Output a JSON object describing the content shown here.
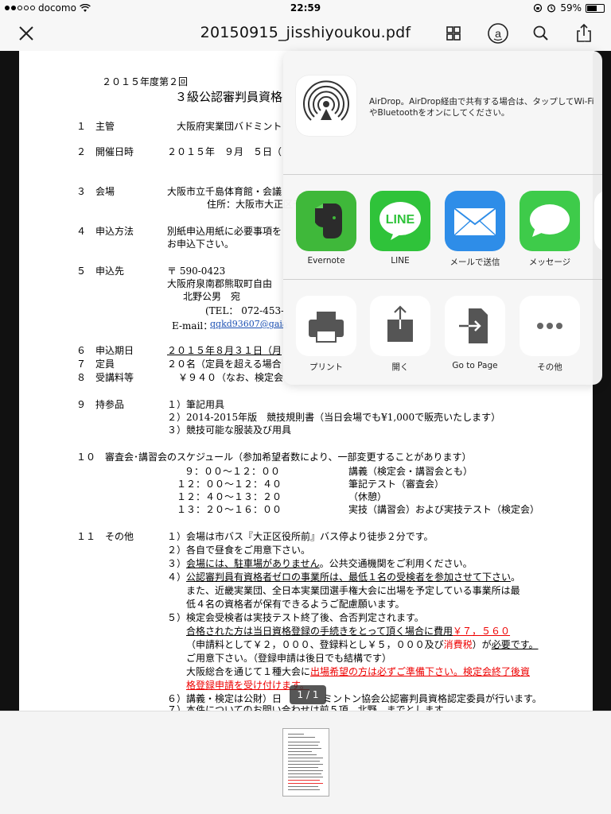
{
  "status_bar": {
    "carrier": "docomo",
    "time": "22:59",
    "battery_percent": "59%",
    "battery_level": 0.59
  },
  "nav": {
    "title": "20150915_jisshiyoukou.pdf",
    "close_icon": "close-icon",
    "grid_icon": "grid-icon",
    "reader_icon": "annotate-icon",
    "search_icon": "search-icon",
    "share_icon": "share-icon"
  },
  "document": {
    "lines": [
      "２０１５年度第２回",
      "３級公認審判員資格",
      "１　主管",
      "大阪府実業団バドミント",
      "２　開催日時",
      "２０１５年　９月　５日（",
      "３　会場",
      "大阪市立千島体育館・会議",
      "住所：大阪市大正区千",
      "４　申込方法",
      "別紙申込用紙に必要事項を",
      "お申込下さい。",
      "５　申込先",
      "〒 590-0423",
      "大阪府泉南郡熊取町自由",
      "北野公男　宛",
      "(TEL：  072-453-",
      "E-mail：",
      "qqkd93607@gaia",
      "６　申込期日",
      "２０１５年８月３１日（月",
      "７　定員",
      "２０名（定員を超える場合",
      "８　受講料等",
      "￥９４０（なお、検定会",
      "９　持参品",
      "１）筆記用具",
      "２）2014-2015年版　競技規則書（当日会場でも¥1,000で販売いたします）",
      "３）競技可能な服装及び用具",
      "１０　審査会･講習会のスケジュール（参加希望者数により、一部変更することがあります）",
      "９：００～１２：００",
      "講義（検定会・講習会とも）",
      "１２：００～１２：４０",
      "筆記テスト（審査会）",
      "１２：４０～１３：２０",
      "（休憩）",
      "１３：２０～１６：００",
      "実技（講習会）および実技テスト（検定会）",
      "１１　その他",
      "１）会場は市バス『大正区役所前』バス停より徒歩２分です。",
      "２）各自で昼食をご用意下さい。",
      "３）",
      "会場には、駐車場がありません",
      "。公共交通機関をご利用ください。",
      "４）",
      "公認審判員有資格者ゼロの事業所は、最低１名の受検者を参加させて下さい",
      "。",
      "また、近畿実業団、全日本実業団選手権大会に出場を予定している事業所は最",
      "低４名の資格者が保有できるようご配慮願います。",
      "５）検定会受検者は実技テスト終了後、合否判定されます。",
      "合格された方は当日資格登録の手続きをとって頂く場合に費用",
      "￥７，５６０",
      "（申請料として￥２，０００、登録料とし￥５，０００及び",
      "消費税",
      "）が",
      "必要です。",
      "ご用意下さい。（登録申請は後日でも結構です）",
      "大阪総合を通じて１種大会に",
      "出場希望の方は必ずご準備下さい。検定会終了後資",
      "格登録申請を受け付けます。",
      "６）講義・検定は公財）日",
      "ミントン協会公認審判員資格認定委員が行います。",
      "７）本件についてのお問い合わせは前５項　北野　までとします。"
    ]
  },
  "share_sheet": {
    "airdrop_text": "AirDrop。AirDrop経由で共有する場合は、タップしてWi-FiやBluetoothをオンにしてください。",
    "airdrop_icon": "airdrop-icon",
    "apps": [
      {
        "label": "Evernote",
        "icon": "evernote-icon",
        "color": "#3fb83a"
      },
      {
        "label": "LINE",
        "icon": "line-icon",
        "color": "#2fc33a"
      },
      {
        "label": "メールで送信",
        "icon": "mail-icon",
        "color": "#2e8de8"
      },
      {
        "label": "メッセージ",
        "icon": "messages-icon",
        "color": "#3ecb4a"
      }
    ],
    "actions": [
      {
        "label": "プリント",
        "icon": "print-icon"
      },
      {
        "label": "開く",
        "icon": "open-in-icon"
      },
      {
        "label": "Go to Page",
        "icon": "go-to-page-icon"
      },
      {
        "label": "その他",
        "icon": "more-icon"
      }
    ]
  },
  "page_indicator": "1 / 1"
}
